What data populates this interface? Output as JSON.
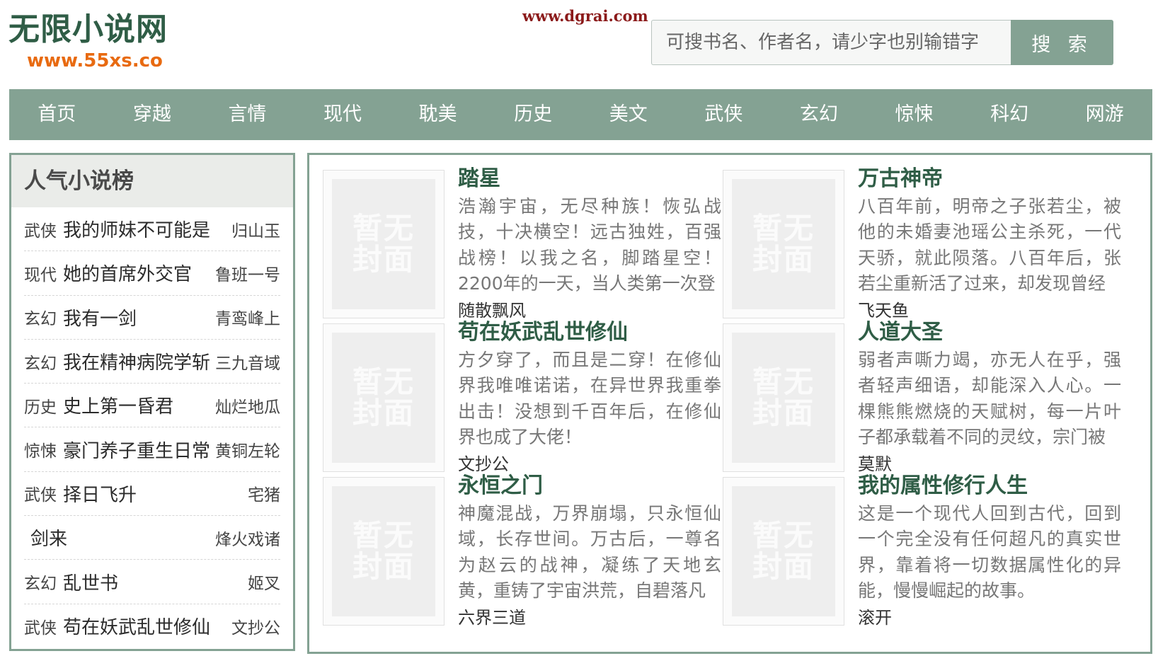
{
  "header": {
    "site_name": "无限小说网",
    "site_url": "www.55xs.co",
    "watermark": "www.dgrai.com",
    "search_placeholder": "可搜书名、作者名，请少字也别输错字",
    "search_button": "搜 索"
  },
  "nav": [
    "首页",
    "穿越",
    "言情",
    "现代",
    "耽美",
    "历史",
    "美文",
    "武侠",
    "玄幻",
    "惊悚",
    "科幻",
    "网游"
  ],
  "ranking": {
    "title": "人气小说榜",
    "items": [
      {
        "category": "武侠",
        "name": "我的师妹不可能是",
        "author": "归山玉"
      },
      {
        "category": "现代",
        "name": "她的首席外交官",
        "author": "鲁班一号"
      },
      {
        "category": "玄幻",
        "name": "我有一剑",
        "author": "青鸾峰上"
      },
      {
        "category": "玄幻",
        "name": "我在精神病院学斩",
        "author": "三九音域"
      },
      {
        "category": "历史",
        "name": "史上第一昏君",
        "author": "灿烂地瓜"
      },
      {
        "category": "惊悚",
        "name": "豪门养子重生日常",
        "author": "黄铜左轮"
      },
      {
        "category": "武侠",
        "name": "择日飞升",
        "author": "宅猪"
      },
      {
        "category": "",
        "name": "剑来",
        "author": "烽火戏诸"
      },
      {
        "category": "玄幻",
        "name": "乱世书",
        "author": "姬叉"
      },
      {
        "category": "武侠",
        "name": "苟在妖武乱世修仙",
        "author": "文抄公"
      }
    ]
  },
  "cover_placeholder": "暂无封面",
  "books": [
    {
      "title": "踏星",
      "desc": "浩瀚宇宙，无尽种族！恢弘战技，十决横空！远古独姓，百强战榜！以我之名，脚踏星空！2200年的一天，当人类第一次登",
      "author": "随散飘风"
    },
    {
      "title": "万古神帝",
      "desc": "八百年前，明帝之子张若尘，被他的未婚妻池瑶公主杀死，一代天骄，就此陨落。八百年后，张若尘重新活了过来，却发现曾经",
      "author": "飞天鱼"
    },
    {
      "title": "苟在妖武乱世修仙",
      "desc": "方夕穿了，而且是二穿！在修仙界我唯唯诺诺，在异世界我重拳出击！没想到千百年后，在修仙界也成了大佬！",
      "author": "文抄公"
    },
    {
      "title": "人道大圣",
      "desc": "弱者声嘶力竭，亦无人在乎，强者轻声细语，却能深入人心。一棵熊熊燃烧的天赋树，每一片叶子都承载着不同的灵纹，宗门被",
      "author": "莫默"
    },
    {
      "title": "永恒之门",
      "desc": "神魔混战，万界崩塌，只永恒仙域，长存世间。万古后，一尊名为赵云的战神，凝练了天地玄黄，重铸了宇宙洪荒，自碧落凡",
      "author": "六界三道"
    },
    {
      "title": "我的属性修行人生",
      "desc": "这是一个现代人回到古代，回到一个完全没有任何超凡的真实世界，靠着将一切数据属性化的异能，慢慢崛起的故事。",
      "author": "滚开"
    }
  ]
}
